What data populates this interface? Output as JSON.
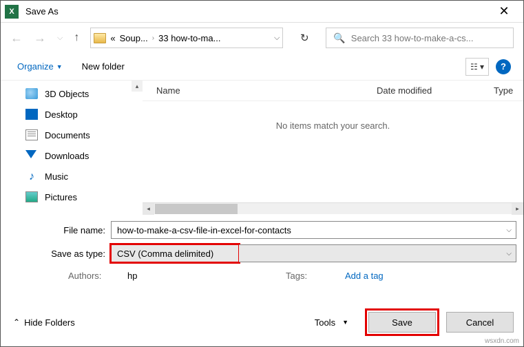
{
  "window": {
    "title": "Save As",
    "app_icon_letter": "X"
  },
  "nav": {
    "crumb1": "Soup...",
    "crumb2": "33 how-to-ma...",
    "search_placeholder": "Search 33 how-to-make-a-cs..."
  },
  "toolbar": {
    "organize": "Organize",
    "new_folder": "New folder"
  },
  "sidebar": {
    "items": [
      {
        "label": "3D Objects"
      },
      {
        "label": "Desktop"
      },
      {
        "label": "Documents"
      },
      {
        "label": "Downloads"
      },
      {
        "label": "Music"
      },
      {
        "label": "Pictures"
      }
    ]
  },
  "columns": {
    "name": "Name",
    "date": "Date modified",
    "type": "Type"
  },
  "content": {
    "empty": "No items match your search."
  },
  "form": {
    "filename_label": "File name:",
    "filename_value": "how-to-make-a-csv-file-in-excel-for-contacts",
    "savetype_label": "Save as type:",
    "savetype_value": "CSV (Comma delimited)",
    "authors_label": "Authors:",
    "authors_value": "hp",
    "tags_label": "Tags:",
    "tags_value": "Add a tag"
  },
  "footer": {
    "hide_folders": "Hide Folders",
    "tools": "Tools",
    "save": "Save",
    "cancel": "Cancel"
  },
  "watermark": "wsxdn.com"
}
